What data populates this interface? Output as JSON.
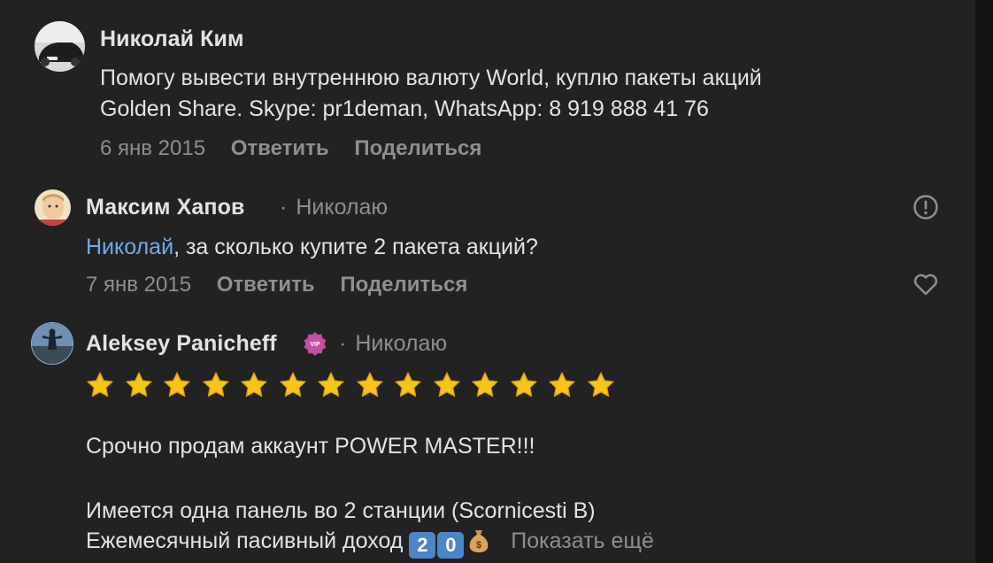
{
  "comments": [
    {
      "author": "Николай Ким",
      "text_lines": [
        "Помогу вывести внутреннюю валюту World, куплю пакеты акций",
        "Golden Share. Skype: pr1deman, WhatsApp: 8 919 888 41 76"
      ],
      "date": "6 янв 2015",
      "reply_label": "Ответить",
      "share_label": "Поделиться"
    },
    {
      "author": "Максим Хапов",
      "reply_to": "Николаю",
      "mention": "Николай",
      "text": ", за сколько купите 2 пакета акций?",
      "date": "7 янв 2015",
      "reply_label": "Ответить",
      "share_label": "Поделиться",
      "report_icon": "exclamation-circle-icon",
      "like_icon": "heart-outline-icon"
    },
    {
      "author": "Aleksey Panicheff",
      "badge": "VIP",
      "reply_to": "Николаю",
      "stars_count": 14,
      "line1": "Срочно продам аккаунт POWER MASTER!!!",
      "line2": "Имеется одна панель во 2 станции (Scornicesti B)",
      "line3": "Ежемесячный пасивный доход",
      "keycaps": [
        "2",
        "0"
      ],
      "money_icon": "money-bag-icon",
      "show_more": "Показать ещё"
    }
  ],
  "colors": {
    "background": "#222222",
    "text": "#e1e3e6",
    "secondary": "#8e8e93",
    "link": "#71aaeb",
    "star": "#f5c518"
  }
}
